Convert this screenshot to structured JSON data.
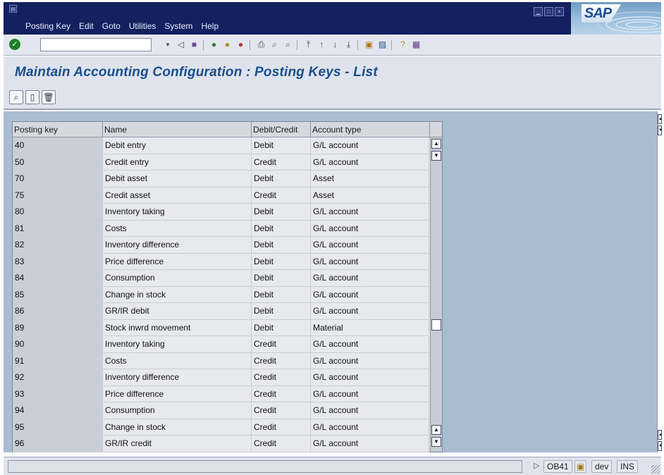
{
  "menubar": {
    "items": [
      {
        "label": "Posting Key",
        "accel": "P"
      },
      {
        "label": "Edit",
        "accel": "E"
      },
      {
        "label": "Goto",
        "accel": "G"
      },
      {
        "label": "Utilities",
        "accel": ""
      },
      {
        "label": "System",
        "accel": ""
      },
      {
        "label": "Help",
        "accel": "H"
      }
    ],
    "logo_text": "SAP"
  },
  "toolbar": {
    "command_field_value": "",
    "icons": [
      "back-icon",
      "save-icon",
      "green-back-icon",
      "exit-icon",
      "cancel-icon",
      "print-icon",
      "find-icon",
      "find-next-icon",
      "first-page-icon",
      "previous-page-icon",
      "next-page-icon",
      "last-page-icon",
      "create-session-icon",
      "shortcut-icon",
      "help-icon",
      "layout-icon"
    ]
  },
  "title": "Maintain Accounting Configuration : Posting Keys - List",
  "app_toolbar": {
    "buttons": [
      "choose-icon",
      "create-icon",
      "delete-icon"
    ]
  },
  "table": {
    "columns": [
      "Posting key",
      "Name",
      "Debit/Credit",
      "Account type"
    ],
    "rows": [
      {
        "key": "40",
        "name": "Debit entry",
        "dc": "Debit",
        "type": "G/L account"
      },
      {
        "key": "50",
        "name": "Credit entry",
        "dc": "Credit",
        "type": "G/L account"
      },
      {
        "key": "70",
        "name": "Debit asset",
        "dc": "Debit",
        "type": "Asset"
      },
      {
        "key": "75",
        "name": "Credit asset",
        "dc": "Credit",
        "type": "Asset"
      },
      {
        "key": "80",
        "name": "Inventory taking",
        "dc": "Debit",
        "type": "G/L account"
      },
      {
        "key": "81",
        "name": "Costs",
        "dc": "Debit",
        "type": "G/L account"
      },
      {
        "key": "82",
        "name": "Inventory difference",
        "dc": "Debit",
        "type": "G/L account"
      },
      {
        "key": "83",
        "name": "Price difference",
        "dc": "Debit",
        "type": "G/L account"
      },
      {
        "key": "84",
        "name": "Consumption",
        "dc": "Debit",
        "type": "G/L account"
      },
      {
        "key": "85",
        "name": "Change in stock",
        "dc": "Debit",
        "type": "G/L account"
      },
      {
        "key": "86",
        "name": "GR/IR debit",
        "dc": "Debit",
        "type": "G/L account"
      },
      {
        "key": "89",
        "name": "Stock inwrd movement",
        "dc": "Debit",
        "type": "Material"
      },
      {
        "key": "90",
        "name": "Inventory taking",
        "dc": "Credit",
        "type": "G/L account"
      },
      {
        "key": "91",
        "name": "Costs",
        "dc": "Credit",
        "type": "G/L account"
      },
      {
        "key": "92",
        "name": "Inventory difference",
        "dc": "Credit",
        "type": "G/L account"
      },
      {
        "key": "93",
        "name": "Price difference",
        "dc": "Credit",
        "type": "G/L account"
      },
      {
        "key": "94",
        "name": "Consumption",
        "dc": "Credit",
        "type": "G/L account"
      },
      {
        "key": "95",
        "name": "Change in stock",
        "dc": "Credit",
        "type": "G/L account"
      },
      {
        "key": "96",
        "name": "GR/IR credit",
        "dc": "Credit",
        "type": "G/L account"
      }
    ]
  },
  "status": {
    "message": "",
    "transaction": "OB41",
    "system": "dev",
    "mode": "INS"
  }
}
